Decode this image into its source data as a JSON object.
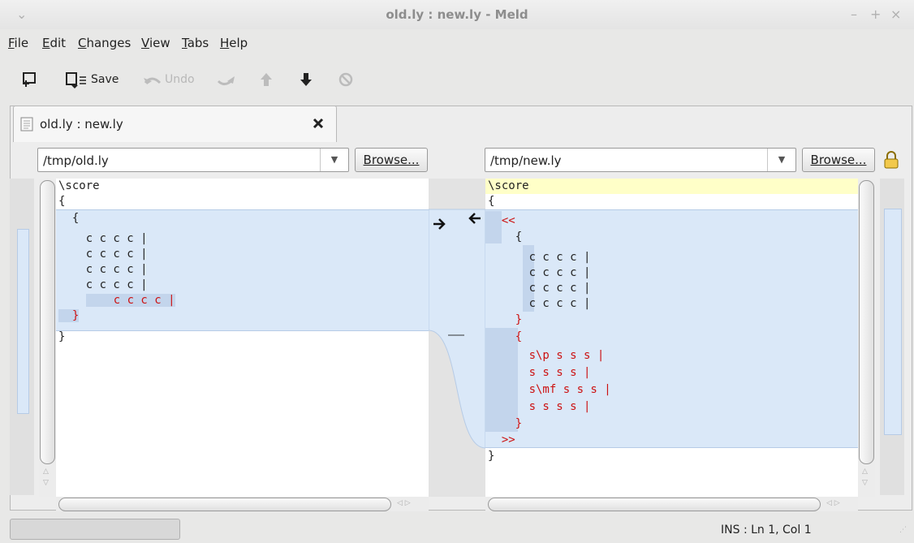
{
  "window": {
    "title": "old.ly : new.ly - Meld",
    "controls": [
      "–",
      "+",
      "×"
    ]
  },
  "menu": [
    {
      "label": "File",
      "u": "F",
      "rest": "ile"
    },
    {
      "label": "Edit",
      "u": "E",
      "rest": "dit"
    },
    {
      "label": "Changes",
      "u": "C",
      "rest": "hanges"
    },
    {
      "label": "View",
      "u": "V",
      "rest": "iew"
    },
    {
      "label": "Tabs",
      "u": "T",
      "rest": "abs"
    },
    {
      "label": "Help",
      "u": "H",
      "rest": "elp"
    }
  ],
  "toolbar": {
    "save_label": "Save",
    "undo_label": "Undo"
  },
  "tab": {
    "label": "old.ly : new.ly"
  },
  "left": {
    "path": "/tmp/old.ly",
    "browse": "Browse...",
    "lines": [
      "\\score",
      "{",
      "  {",
      "    c c c c |",
      "    c c c c |",
      "    c c c c |",
      "    c c c c |",
      "    c c c c |",
      "  }",
      "}"
    ]
  },
  "right": {
    "path": "/tmp/new.ly",
    "browse": "Browse...",
    "lines": [
      "\\score",
      "{",
      "  <<",
      "    {",
      "      c c c c |",
      "      c c c c |",
      "      c c c c |",
      "      c c c c |",
      "    }",
      "    {",
      "      s\\p s s s |",
      "      s s s s |",
      "      s\\mf s s s |",
      "      s s s s |",
      "    }",
      "  >>",
      "}"
    ]
  },
  "status": {
    "position": "INS : Ln 1, Col 1"
  },
  "colors": {
    "change_fill": "#dae8f8",
    "change_line": "#c3d5ec",
    "inserted_text": "#cc1111",
    "current_line": "#ffffc8"
  }
}
